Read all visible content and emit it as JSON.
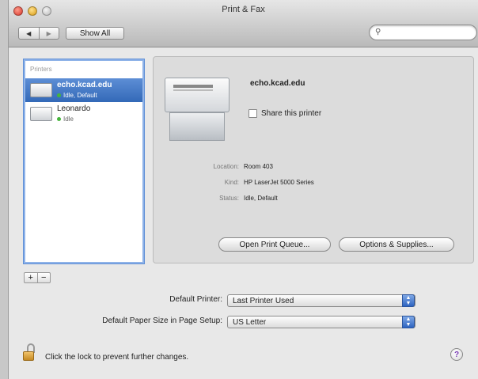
{
  "window": {
    "title": "Print & Fax"
  },
  "toolbar": {
    "back_icon": "back-arrow-icon",
    "forward_icon": "forward-arrow-icon",
    "show_all_label": "Show All",
    "search_placeholder": ""
  },
  "printers": {
    "header": "Printers",
    "items": [
      {
        "name": "echo.kcad.edu",
        "status": "Idle, Default",
        "selected": true
      },
      {
        "name": "Leonardo",
        "status": "Idle",
        "selected": false
      }
    ],
    "add_label": "+",
    "remove_label": "−"
  },
  "detail": {
    "printer_name": "echo.kcad.edu",
    "share_label": "Share this printer",
    "share_checked": false,
    "location_label": "Location:",
    "location_value": "Room 403",
    "kind_label": "Kind:",
    "kind_value": "HP LaserJet 5000 Series",
    "status_label": "Status:",
    "status_value": "Idle, Default",
    "open_queue_label": "Open Print Queue...",
    "options_label": "Options & Supplies..."
  },
  "settings": {
    "default_printer_label": "Default Printer:",
    "default_printer_value": "Last Printer Used",
    "paper_size_label": "Default Paper Size in Page Setup:",
    "paper_size_value": "US Letter"
  },
  "footer": {
    "lock_text": "Click the lock to prevent further changes.",
    "help_label": "?"
  },
  "colors": {
    "selection": "#3d74c7",
    "status_dot": "#45b53b",
    "popup_arrow": "#2e64c0"
  }
}
